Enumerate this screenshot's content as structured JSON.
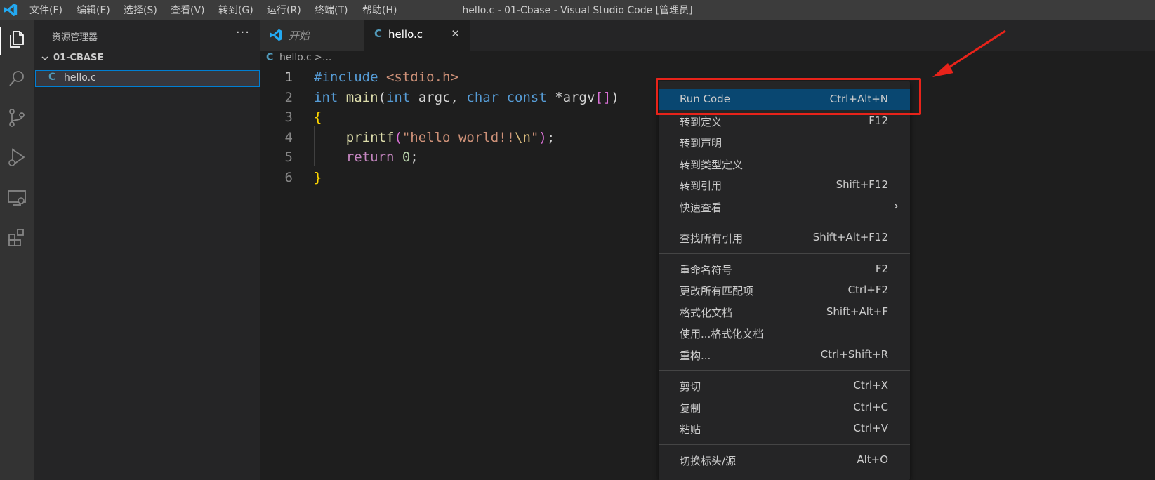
{
  "titlebar": {
    "menu": [
      "文件(F)",
      "编辑(E)",
      "选择(S)",
      "查看(V)",
      "转到(G)",
      "运行(R)",
      "终端(T)",
      "帮助(H)"
    ],
    "title": "hello.c - 01-Cbase - Visual Studio Code [管理员]"
  },
  "activitybar": {
    "icons": [
      "explorer-icon",
      "search-icon",
      "source-control-icon",
      "run-debug-icon",
      "remote-explorer-icon",
      "extensions-icon"
    ]
  },
  "sidebar": {
    "header": "资源管理器",
    "more": "···",
    "folder": "01-CBASE",
    "files": [
      {
        "icon": "C",
        "name": "hello.c"
      }
    ]
  },
  "tabs": [
    {
      "label": "开始",
      "icon": "vscode-icon",
      "active": false
    },
    {
      "label": "hello.c",
      "icon": "C",
      "active": true,
      "close": "✕"
    }
  ],
  "breadcrumb": {
    "file_icon": "C",
    "file": "hello.c",
    "separator": ">",
    "more": "..."
  },
  "editor": {
    "line_numbers": [
      "1",
      "2",
      "3",
      "4",
      "5",
      "6"
    ],
    "lines": [
      [
        {
          "t": "#include ",
          "c": "kw"
        },
        {
          "t": "<stdio.h>",
          "c": "str"
        }
      ],
      [
        {
          "t": "int ",
          "c": "kw"
        },
        {
          "t": "main",
          "c": "fn"
        },
        {
          "t": "(",
          "c": "id"
        },
        {
          "t": "int ",
          "c": "kw"
        },
        {
          "t": "argc, ",
          "c": "id"
        },
        {
          "t": "char ",
          "c": "kw"
        },
        {
          "t": "const ",
          "c": "kw"
        },
        {
          "t": "*argv",
          "c": "id"
        },
        {
          "t": "[]",
          "c": "bracket"
        },
        {
          "t": ")",
          "c": "id"
        }
      ],
      [
        {
          "t": "{",
          "c": "brace"
        }
      ],
      [
        {
          "t": "    ",
          "c": "id"
        },
        {
          "t": "printf",
          "c": "fn"
        },
        {
          "t": "(",
          "c": "bracket"
        },
        {
          "t": "\"hello world!!",
          "c": "str"
        },
        {
          "t": "\\n",
          "c": "esc"
        },
        {
          "t": "\"",
          "c": "str"
        },
        {
          "t": ")",
          "c": "bracket"
        },
        {
          "t": ";",
          "c": "id"
        }
      ],
      [
        {
          "t": "    ",
          "c": "id"
        },
        {
          "t": "return ",
          "c": "ctl"
        },
        {
          "t": "0",
          "c": "num"
        },
        {
          "t": ";",
          "c": "id"
        }
      ],
      [
        {
          "t": "}",
          "c": "brace"
        }
      ]
    ],
    "active_line": 1
  },
  "context_menu": {
    "groups": [
      [
        {
          "label": "Run Code",
          "shortcut": "Ctrl+Alt+N",
          "selected": true
        },
        {
          "label": "转到定义",
          "shortcut": "F12"
        },
        {
          "label": "转到声明",
          "shortcut": ""
        },
        {
          "label": "转到类型定义",
          "shortcut": ""
        },
        {
          "label": "转到引用",
          "shortcut": "Shift+F12"
        },
        {
          "label": "快速查看",
          "shortcut": "",
          "submenu": "›"
        }
      ],
      [
        {
          "label": "查找所有引用",
          "shortcut": "Shift+Alt+F12"
        }
      ],
      [
        {
          "label": "重命名符号",
          "shortcut": "F2"
        },
        {
          "label": "更改所有匹配项",
          "shortcut": "Ctrl+F2"
        },
        {
          "label": "格式化文档",
          "shortcut": "Shift+Alt+F"
        },
        {
          "label": "使用...格式化文档",
          "shortcut": ""
        },
        {
          "label": "重构...",
          "shortcut": "Ctrl+Shift+R"
        }
      ],
      [
        {
          "label": "剪切",
          "shortcut": "Ctrl+X"
        },
        {
          "label": "复制",
          "shortcut": "Ctrl+C"
        },
        {
          "label": "粘贴",
          "shortcut": "Ctrl+V"
        }
      ],
      [
        {
          "label": "切换标头/源",
          "shortcut": "Alt+O"
        }
      ]
    ]
  },
  "annotation": {
    "color": "#e8231a"
  },
  "colors": {
    "accent": "#007acc",
    "selection": "#094771"
  }
}
